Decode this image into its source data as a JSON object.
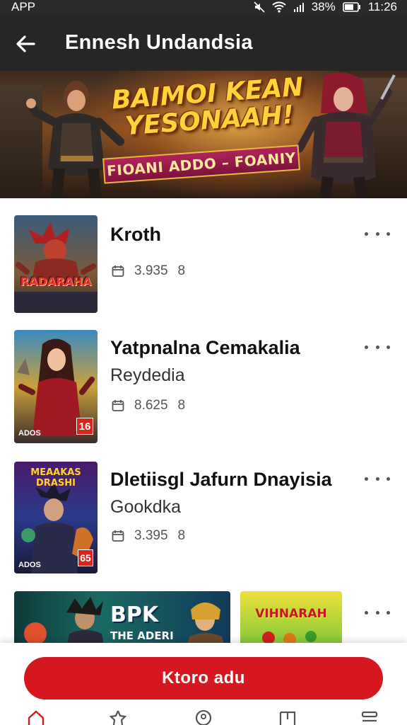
{
  "status_bar": {
    "left_label": "APP",
    "battery": "38%",
    "time": "11:26"
  },
  "app_bar": {
    "title": "Ennesh Undandsia"
  },
  "banner": {
    "headline_line1": "BAIMOI KEAN",
    "headline_line2": "YESONAAH!",
    "ribbon": "FIOANI ADDO – FOANIY"
  },
  "items": [
    {
      "title": "Kroth",
      "subtitle": "",
      "meta_count": "3.935",
      "meta_extra": "8",
      "thumb_label": "RADARAHA"
    },
    {
      "title": "Yatpnalna Cemakalia",
      "subtitle": "Reydedia",
      "meta_count": "8.625",
      "meta_extra": "8",
      "thumb_corner": "ADOS",
      "thumb_badge": "16"
    },
    {
      "title": "Dletiisgl Jafurn Dnayisia",
      "subtitle": "Gookdka",
      "meta_count": "3.395",
      "meta_extra": "8",
      "thumb_label": "MEAAKAS DRASHI",
      "thumb_corner": "ADOS",
      "thumb_badge": "65"
    }
  ],
  "partial_row": {
    "card_a_line1": "BPK",
    "card_a_line2": "THE ADERI",
    "card_b_label": "VIHNARAH"
  },
  "cta": {
    "label": "Ktoro adu"
  },
  "colors": {
    "accent": "#d5171f",
    "app_bar": "#262626",
    "status_bar": "#2a2a2a"
  },
  "nav": {
    "icons": [
      "home-icon",
      "star-icon",
      "pin-icon",
      "book-icon",
      "menu-icon"
    ]
  }
}
